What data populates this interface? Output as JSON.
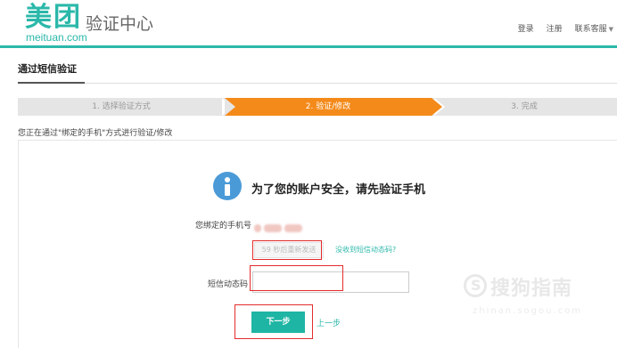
{
  "header": {
    "logo_cn": "美团",
    "logo_en": "meituan.com",
    "site_title": "验证中心",
    "nav": {
      "login": "登录",
      "register": "注册",
      "support": "联系客服"
    }
  },
  "section": {
    "title": "通过短信验证"
  },
  "steps": [
    {
      "label": "1. 选择验证方式",
      "state": "done"
    },
    {
      "label": "2. 验证/修改",
      "state": "active"
    },
    {
      "label": "3. 完成",
      "state": "pending"
    }
  ],
  "info_line": "您正在通过\"绑定的手机\"方式进行验证/修改",
  "verify": {
    "headline": "为了您的账户安全，请先验证手机",
    "phone_label": "您绑定的手机号",
    "resend_label": "59 秒后重新发送",
    "not_received": "没收到短信动态码?",
    "code_label": "短信动态码",
    "code_value": "",
    "next_button": "下一步",
    "prev_link": "上一步"
  },
  "watermark": {
    "text": "搜狗指南",
    "sub": "zhinan.sogou.com"
  },
  "colors": {
    "brand": "#2bb8aa",
    "active_step": "#f48a1a",
    "button": "#1fb5a4",
    "highlight_box": "#e42b2b",
    "info_icon": "#4a9ad8"
  }
}
